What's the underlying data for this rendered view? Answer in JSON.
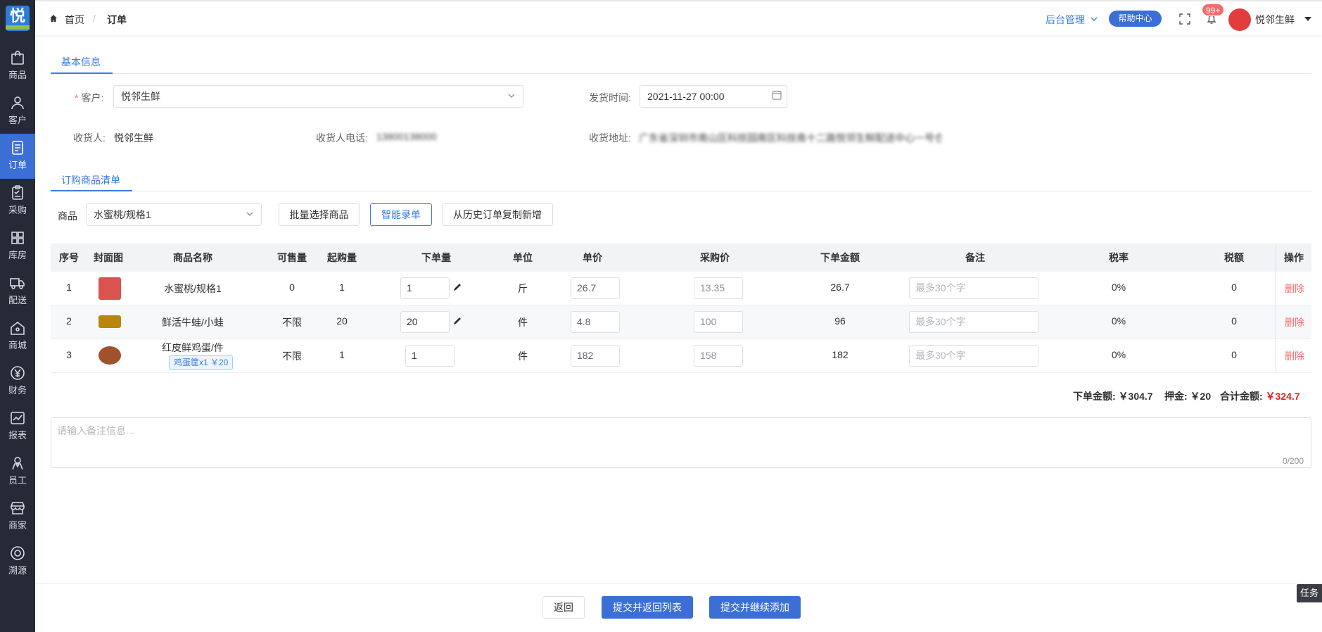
{
  "sidebar": {
    "logo": "悦",
    "items": [
      {
        "label": "商品",
        "icon": "bag-icon"
      },
      {
        "label": "客户",
        "icon": "person-icon"
      },
      {
        "label": "订单",
        "icon": "document-icon",
        "active": true
      },
      {
        "label": "采购",
        "icon": "clipboard-icon"
      },
      {
        "label": "库房",
        "icon": "grid-icon"
      },
      {
        "label": "配送",
        "icon": "truck-icon"
      },
      {
        "label": "商城",
        "icon": "house-icon"
      },
      {
        "label": "财务",
        "icon": "yen-icon"
      },
      {
        "label": "报表",
        "icon": "chart-icon"
      },
      {
        "label": "员工",
        "icon": "staff-icon"
      },
      {
        "label": "商家",
        "icon": "store-icon"
      },
      {
        "label": "溯源",
        "icon": "target-icon"
      }
    ]
  },
  "header": {
    "breadcrumb_home": "首页",
    "breadcrumb_sep": "/",
    "breadcrumb_current": "订单",
    "admin_menu": "后台管理",
    "help": "帮助中心",
    "badge": "99+",
    "user": "悦邻生鲜"
  },
  "basic": {
    "tab": "基本信息",
    "customer_label": "客户:",
    "customer_value": "悦邻生鲜",
    "ship_time_label": "发货时间:",
    "ship_time_value": "2021-11-27 00:00",
    "receiver_label": "收货人:",
    "receiver_value": "悦邻生鲜",
    "phone_label": "收货人电话:",
    "phone_value": "13800138000",
    "address_label": "收货地址:",
    "address_value": "广东省深圳市南山区科技园南区科技南十二路悦邻生鲜配送中心一号仓库"
  },
  "goods": {
    "tab": "订购商品清单",
    "product_label": "商品",
    "product_value": "水蜜桃/规格1",
    "btn_batch": "批量选择商品",
    "btn_smart": "智能录单",
    "btn_history": "从历史订单复制新增"
  },
  "table": {
    "headers": [
      "序号",
      "封面图",
      "商品名称",
      "可售量",
      "起购量",
      "下单量",
      "单位",
      "单价",
      "采购价",
      "下单金额",
      "备注",
      "税率",
      "税额",
      "操作"
    ],
    "remark_placeholder": "最多30个字",
    "delete_label": "删除",
    "rows": [
      {
        "no": "1",
        "name": "水蜜桃/规格1",
        "stock": "0",
        "min": "1",
        "qty": "1",
        "unit": "斤",
        "price": "26.7",
        "cost": "13.35",
        "amount": "26.7",
        "tax_rate": "0%",
        "tax": "0",
        "thumb_color": "#d9534f",
        "editable": true
      },
      {
        "no": "2",
        "name": "鲜活牛蛙/小蛙",
        "stock": "不限",
        "min": "20",
        "qty": "20",
        "unit": "件",
        "price": "4.8",
        "cost": "100",
        "amount": "96",
        "tax_rate": "0%",
        "tax": "0",
        "thumb_color": "#b8860b",
        "editable": true
      },
      {
        "no": "3",
        "name": "红皮鲜鸡蛋/件",
        "tag": "鸡蛋筐x1 ￥20",
        "stock": "不限",
        "min": "1",
        "qty": "1",
        "unit": "件",
        "price": "182",
        "cost": "158",
        "amount": "182",
        "tax_rate": "0%",
        "tax": "0",
        "thumb_color": "#a0522d",
        "editable": false
      }
    ]
  },
  "summary": {
    "order_amount_label": "下单金额:",
    "order_amount": "￥304.7",
    "deposit_label": "押金:",
    "deposit": "￥20",
    "total_label": "合计金额:",
    "total": "￥324.7"
  },
  "remark": {
    "placeholder": "请输入备注信息...",
    "count": "0/200"
  },
  "footer": {
    "back": "返回",
    "submit_return": "提交并返回列表",
    "submit_continue": "提交并继续添加"
  },
  "task": "任务",
  "colors": {
    "primary": "#3b6fd6",
    "sidebar": "#262a36",
    "danger": "#f56c6c"
  }
}
